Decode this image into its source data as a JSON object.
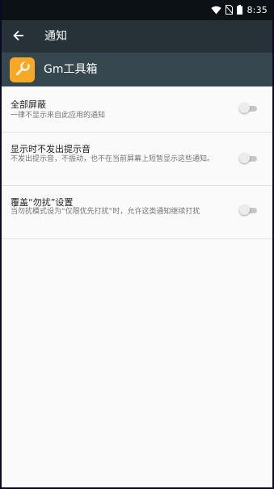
{
  "status_bar": {
    "time": "8:35",
    "icons": [
      "wifi-icon",
      "no-sim-icon",
      "battery-icon"
    ]
  },
  "toolbar": {
    "back_icon": "arrow-left-icon",
    "title": "通知"
  },
  "app_header": {
    "icon": "wrench-icon",
    "icon_color": "#f9a825",
    "app_name": "Gm工具箱"
  },
  "settings": [
    {
      "title": "全部屏蔽",
      "description": "一律不显示来自此应用的通知",
      "enabled": false
    },
    {
      "title": "显示时不发出提示音",
      "description": "不发出提示音，不振动，也不在当前屏幕上短暂显示这些通知。",
      "enabled": false
    },
    {
      "title": "覆盖“勿扰”设置",
      "description": "当勿扰模式设为“仅限优先打扰”时，允许这类通知继续打扰",
      "enabled": false
    }
  ],
  "colors": {
    "status_bar": "#0b1114",
    "toolbar": "#263238",
    "app_header": "#37474f",
    "background": "#fafafa"
  }
}
